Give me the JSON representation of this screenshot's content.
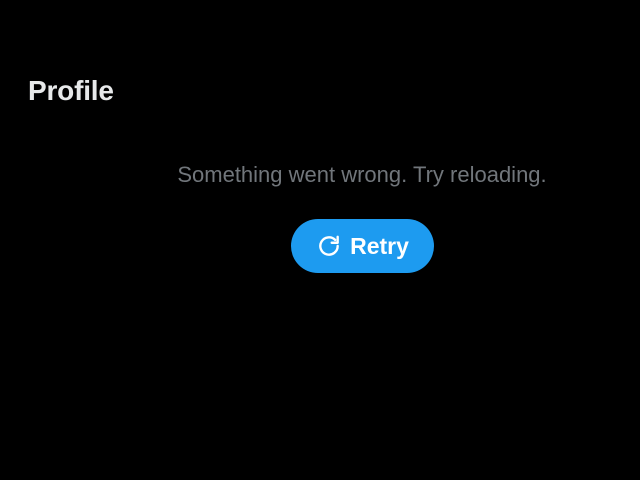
{
  "header": {
    "title": "Profile"
  },
  "error": {
    "message": "Something went wrong. Try reloading.",
    "retry_label": "Retry",
    "retry_icon": "refresh-icon"
  },
  "colors": {
    "background": "#000000",
    "title": "#e7e9ea",
    "message": "#71767b",
    "accent": "#1d9bf0",
    "button_text": "#ffffff"
  }
}
